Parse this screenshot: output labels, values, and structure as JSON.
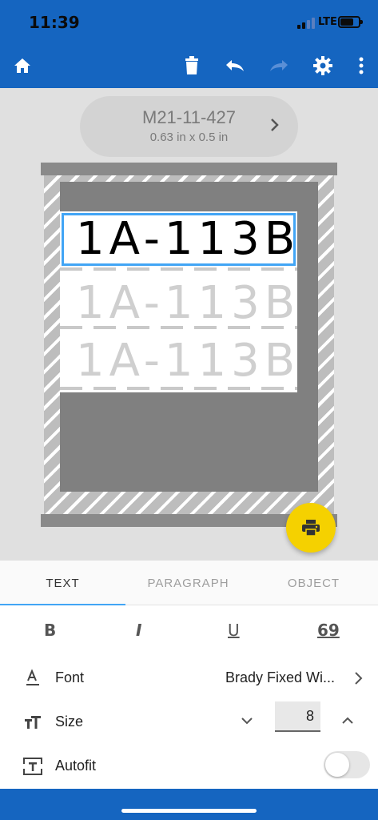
{
  "status": {
    "time": "11:39",
    "network": "LTE"
  },
  "toolbar": {
    "home_icon": "home-icon",
    "delete_icon": "trash-icon",
    "undo_icon": "undo-icon",
    "redo_icon": "redo-icon",
    "settings_icon": "gear-icon",
    "more_icon": "more-vert-icon"
  },
  "label": {
    "name": "M21-11-427",
    "size": "0.63 in x 0.5 in"
  },
  "preview": {
    "rows": [
      "1A-113B",
      "1A-113B",
      "1A-113B"
    ]
  },
  "tabs": [
    {
      "label": "TEXT",
      "active": true
    },
    {
      "label": "PARAGRAPH",
      "active": false
    },
    {
      "label": "OBJECT",
      "active": false
    }
  ],
  "format": {
    "bold": "B",
    "italic": "I",
    "underline": "U",
    "rotate": "69"
  },
  "props": {
    "font_label": "Font",
    "font_value": "Brady Fixed Wi...",
    "size_label": "Size",
    "size_value": "8",
    "autofit_label": "Autofit",
    "autofit_on": false
  },
  "colors": {
    "accent": "#1565c0",
    "fab": "#f5d100",
    "selection": "#42a5f5"
  }
}
